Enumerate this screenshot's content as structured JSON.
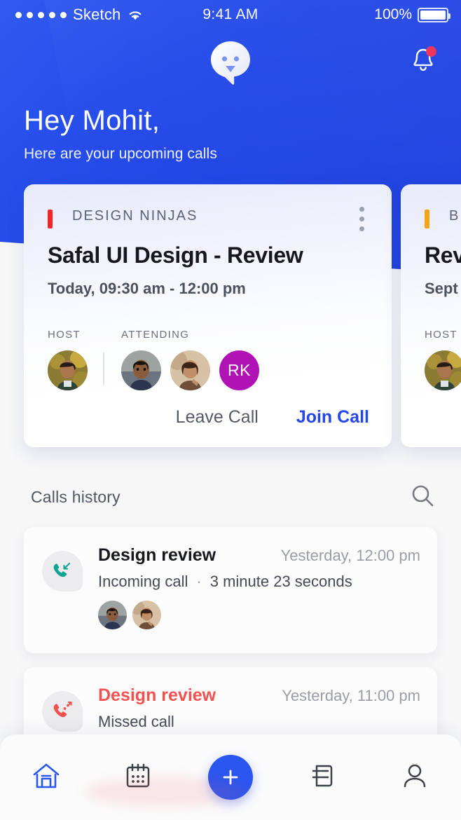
{
  "status_bar": {
    "carrier": "Sketch",
    "signal_dots": 5,
    "wifi_icon": "wifi-icon",
    "time": "9:41 AM",
    "battery_percent": "100%",
    "battery_icon": "battery-full-icon"
  },
  "header": {
    "logo_icon": "chat-ghost-logo",
    "notifications_icon": "bell-icon",
    "has_notification_badge": true,
    "greeting": "Hey Mohit,",
    "subtitle": "Here are your upcoming calls",
    "background_color": "#2B56F0"
  },
  "upcoming_calls": [
    {
      "org": "DESIGN NINJAS",
      "accent_color": "#F4252B",
      "title": "Safal UI Design - Review",
      "time": "Today, 09:30 am - 12:00 pm",
      "menu_icon": "kebab-menu-icon",
      "host_label": "HOST",
      "attending_label": "ATTENDING",
      "host": {
        "type": "photo",
        "name": "host-avatar"
      },
      "attendees": [
        {
          "type": "photo",
          "name": "attendee-avatar-1"
        },
        {
          "type": "photo",
          "name": "attendee-avatar-2"
        },
        {
          "type": "initials",
          "initials": "RK",
          "color": "#B012B5"
        }
      ],
      "leave_label": "Leave Call",
      "join_label": "Join Call",
      "join_color": "#2347E8"
    },
    {
      "org": "BL",
      "accent_color": "#F6A417",
      "title": "Rev",
      "time": "Sept",
      "host_label": "HOST",
      "host": {
        "type": "photo",
        "name": "host-avatar"
      }
    }
  ],
  "calls_history": {
    "section_title": "Calls history",
    "search_icon": "search-icon",
    "items": [
      {
        "icon": "incoming-call-icon",
        "icon_color": "#0FA391",
        "name": "Design review",
        "name_color": "#16181D",
        "when": "Yesterday, 12:00 pm",
        "type": "Incoming call",
        "separator": "·",
        "duration": "3 minute 23 seconds",
        "participants": [
          "participant-avatar-1",
          "participant-avatar-2"
        ]
      },
      {
        "icon": "missed-call-icon",
        "icon_color": "#F0534F",
        "name": "Design review",
        "name_color": "#F0534F",
        "when": "Yesterday, 11:00 pm",
        "type": "Missed call",
        "separator": "",
        "duration": "",
        "participants": []
      }
    ]
  },
  "bottom_nav": {
    "items": [
      {
        "icon": "home-icon",
        "active": true
      },
      {
        "icon": "calendar-icon",
        "active": false
      },
      {
        "icon": "plus-icon",
        "active": false,
        "is_fab": true
      },
      {
        "icon": "notes-list-icon",
        "active": false
      },
      {
        "icon": "person-icon",
        "active": false
      }
    ],
    "active_color": "#2B56F0",
    "inactive_color": "#3C4048"
  }
}
